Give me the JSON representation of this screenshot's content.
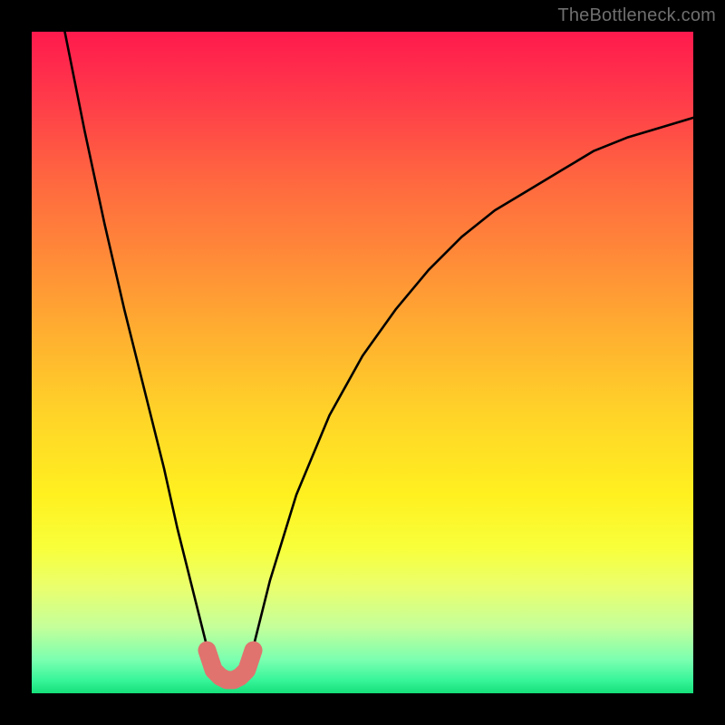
{
  "watermark": "TheBottleneck.com",
  "chart_data": {
    "type": "line",
    "title": "",
    "xlabel": "",
    "ylabel": "",
    "xlim": [
      0,
      100
    ],
    "ylim": [
      0,
      100
    ],
    "series": [
      {
        "name": "curve",
        "x": [
          5,
          8,
          11,
          14,
          17,
          20,
          22,
          24,
          26,
          27,
          28,
          29,
          30,
          31,
          32,
          33,
          34,
          36,
          40,
          45,
          50,
          55,
          60,
          65,
          70,
          75,
          80,
          85,
          90,
          95,
          100
        ],
        "y": [
          100,
          85,
          71,
          58,
          46,
          34,
          25,
          17,
          9,
          5,
          3,
          2,
          2,
          2,
          3,
          5,
          9,
          17,
          30,
          42,
          51,
          58,
          64,
          69,
          73,
          76,
          79,
          82,
          84,
          85.5,
          87
        ]
      }
    ],
    "highlight": {
      "name": "valley-highlight",
      "color": "#e0736e",
      "x": [
        26.5,
        27.5,
        28.5,
        29.5,
        30.5,
        31.5,
        32.5,
        33.5
      ],
      "y": [
        6.5,
        3.5,
        2.5,
        2,
        2,
        2.5,
        3.5,
        6.5
      ]
    },
    "background_gradient_top": "#ff1a4d",
    "background_gradient_bottom": "#15e07a"
  }
}
